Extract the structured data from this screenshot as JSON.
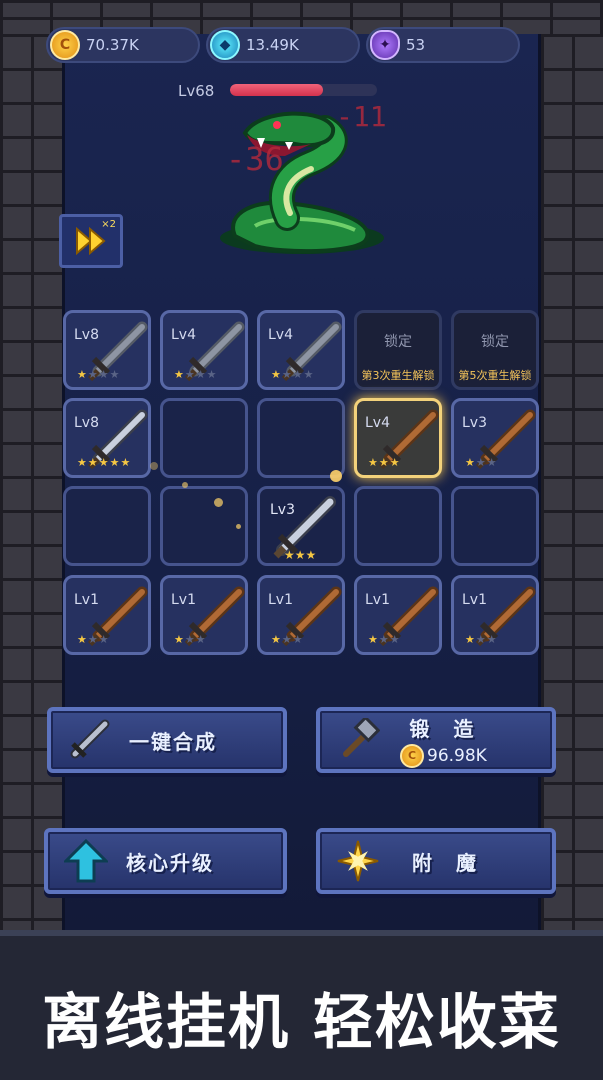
{
  "currencies": {
    "coins": {
      "value": "70.37K",
      "icon": "coin-icon",
      "color": "#f5b325"
    },
    "gems": {
      "value": "13.49K",
      "icon": "gem-icon",
      "color": "#2fc7e8"
    },
    "souls": {
      "value": "53",
      "icon": "soul-icon",
      "color": "#8a55e0"
    }
  },
  "enemy": {
    "level": "Lv68",
    "hp_fraction": 0.63,
    "name_icon": "snake-boss",
    "damage_numbers": [
      "-11",
      "-36"
    ]
  },
  "speed_button": {
    "multiplier": "×2",
    "icon": "fast-forward-icon"
  },
  "grid": {
    "rows": [
      [
        {
          "level": "Lv8",
          "stars": 1,
          "max_stars": 4,
          "weapon": "iron-sword"
        },
        {
          "level": "Lv4",
          "stars": 1,
          "max_stars": 4,
          "weapon": "iron-sword"
        },
        {
          "level": "Lv4",
          "stars": 1,
          "max_stars": 4,
          "weapon": "iron-sword"
        },
        {
          "locked": true,
          "lock_label": "锁定",
          "unlock_note": "第3次重生解锁"
        },
        {
          "locked": true,
          "lock_label": "锁定",
          "unlock_note": "第5次重生解锁"
        }
      ],
      [
        {
          "level": "Lv8",
          "stars": 5,
          "max_stars": 5,
          "weapon": "steel-sword"
        },
        {
          "empty": true
        },
        {
          "empty": true
        },
        {
          "level": "Lv4",
          "stars": 3,
          "max_stars": 3,
          "weapon": "wood-sword",
          "highlight": true
        },
        {
          "level": "Lv3",
          "stars": 1,
          "max_stars": 3,
          "weapon": "wood-sword"
        }
      ],
      [
        {
          "empty": true
        },
        {
          "empty": true
        },
        {
          "empty": true
        },
        {
          "empty": true
        },
        {
          "empty": true
        }
      ],
      [
        {
          "level": "Lv1",
          "stars": 1,
          "max_stars": 3,
          "weapon": "wood-sword"
        },
        {
          "level": "Lv1",
          "stars": 1,
          "max_stars": 3,
          "weapon": "wood-sword"
        },
        {
          "level": "Lv1",
          "stars": 1,
          "max_stars": 3,
          "weapon": "wood-sword"
        },
        {
          "level": "Lv1",
          "stars": 1,
          "max_stars": 3,
          "weapon": "wood-sword"
        },
        {
          "level": "Lv1",
          "stars": 1,
          "max_stars": 3,
          "weapon": "wood-sword"
        }
      ]
    ],
    "dragging": {
      "level": "Lv3",
      "stars": "★★★",
      "weapon": "steel-sword"
    }
  },
  "actions": {
    "auto_merge": "一键合成",
    "forge": "锻　造",
    "forge_price": "96.98K",
    "core_upgrade": "核心升级",
    "enchant": "附　魔"
  },
  "banner": "离线挂机 轻松收菜"
}
